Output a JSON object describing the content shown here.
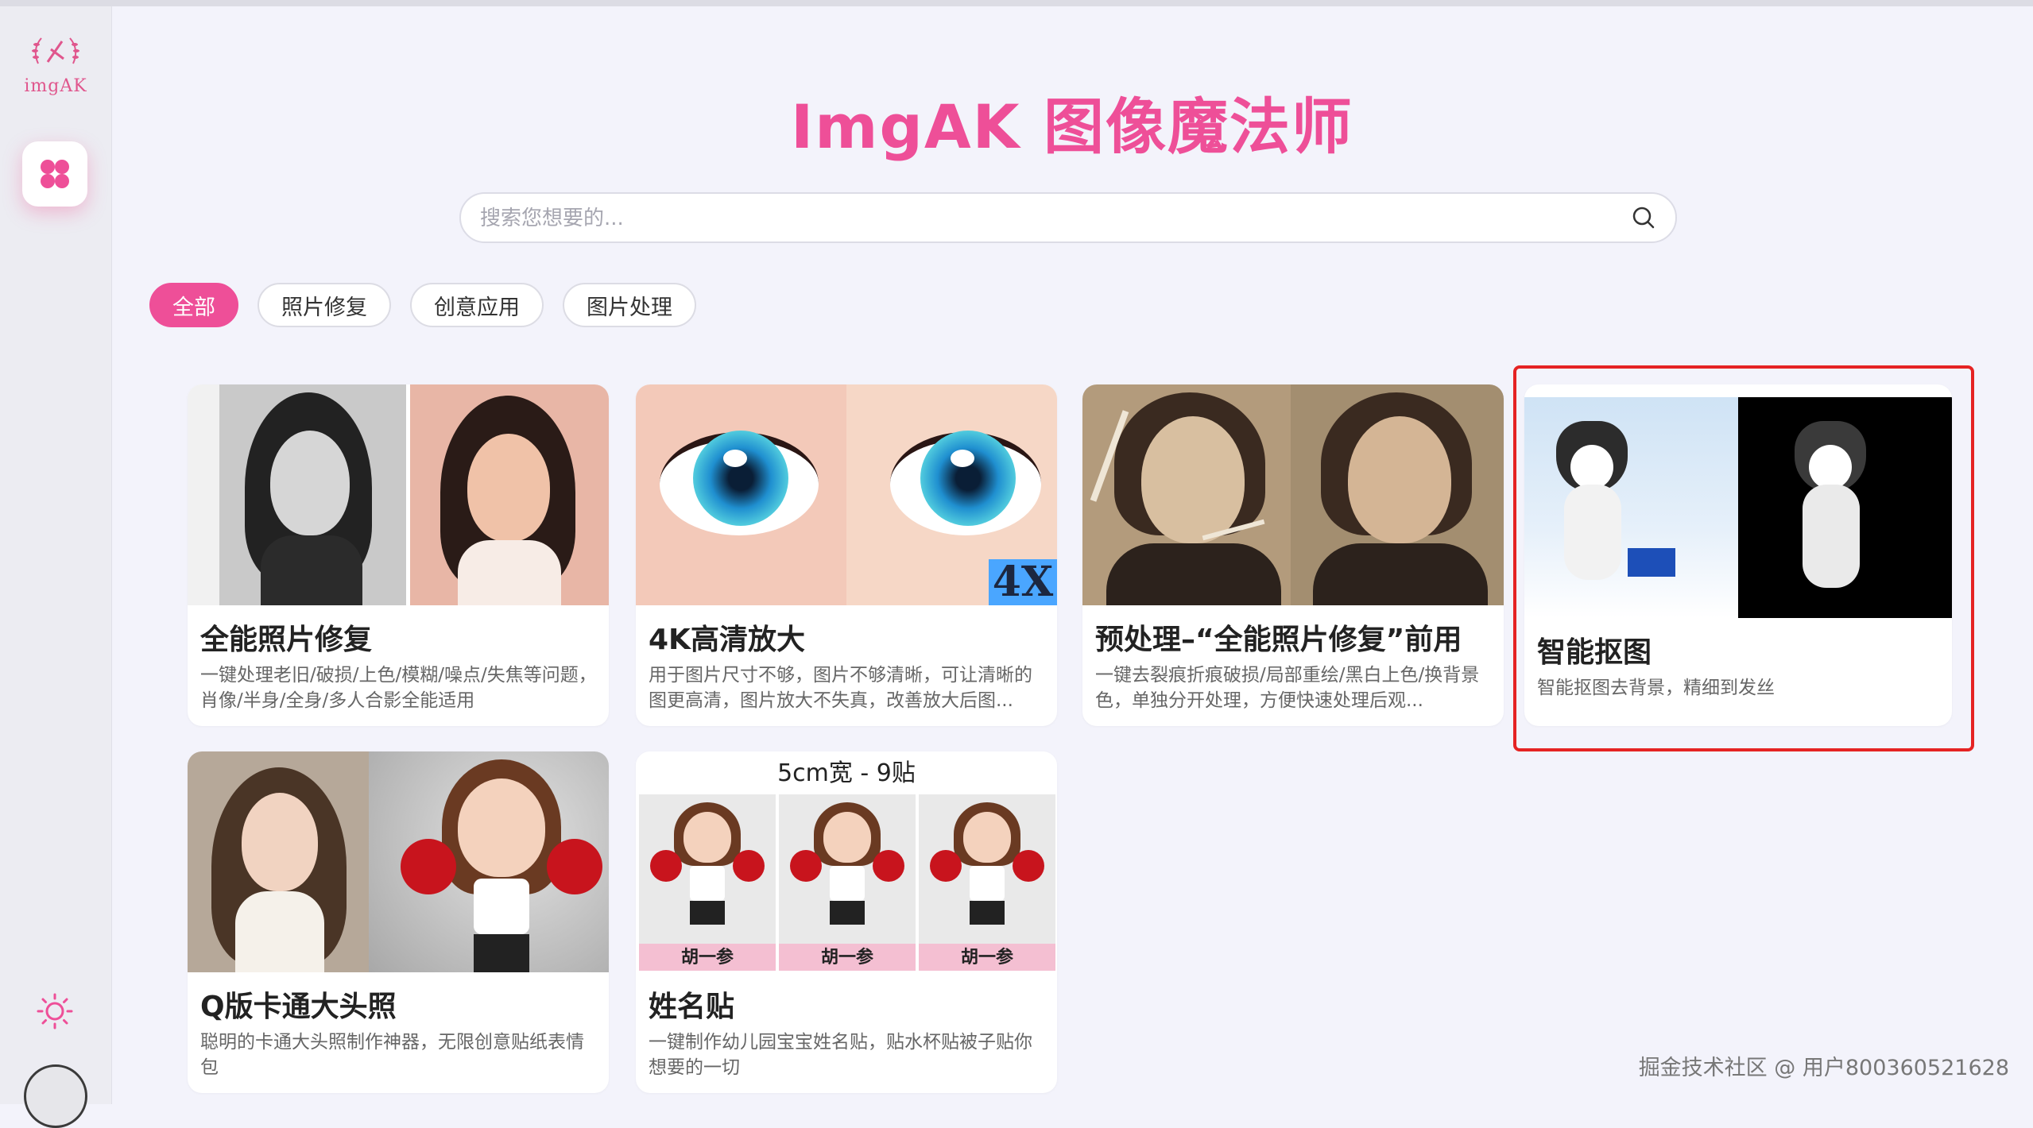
{
  "app": {
    "logo_text": "imgAK",
    "title": "ImgAK  图像魔法师"
  },
  "search": {
    "placeholder": "搜索您想要的..."
  },
  "tabs": [
    {
      "label": "全部",
      "active": true
    },
    {
      "label": "照片修复",
      "active": false
    },
    {
      "label": "创意应用",
      "active": false
    },
    {
      "label": "图片处理",
      "active": false
    }
  ],
  "cards": [
    {
      "title": "全能照片修复",
      "desc": "一键处理老旧/破损/上色/模糊/噪点/失焦等问题，肖像/半身/全身/多人合影全能适用"
    },
    {
      "title": "4K高清放大",
      "desc": "用于图片尺寸不够，图片不够清晰，可让清晰的图更高清，图片放大不失真，改善放大后图...",
      "badge": "4X"
    },
    {
      "title": "预处理–“全能照片修复”前用",
      "desc": "一键去裂痕折痕破损/局部重绘/黑白上色/换背景色，单独分开处理，方便快速处理后观..."
    },
    {
      "title": "智能抠图",
      "desc": "智能抠图去背景，精细到发丝"
    },
    {
      "title": "Q版卡通大头照",
      "desc": "聪明的卡通大头照制作神器，无限创意贴纸表情包"
    },
    {
      "title": "姓名贴",
      "desc": "一键制作幼儿园宝宝姓名贴，贴水杯贴被子贴你想要的一切",
      "image_header": "5cm宽 - 9贴",
      "sticker_name": "胡一参"
    }
  ],
  "watermark": "掘金技术社区 @ 用户800360521628",
  "colors": {
    "accent": "#ee4f98",
    "highlight": "#e52323"
  }
}
